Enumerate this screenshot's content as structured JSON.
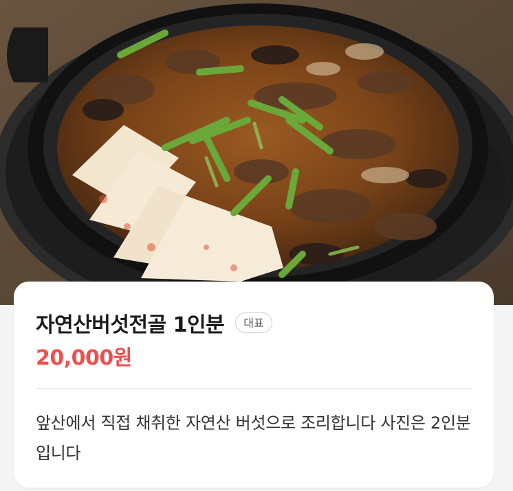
{
  "menu_item": {
    "name": "자연산버섯전골 1인분",
    "badge": "대표",
    "price": "20,000원",
    "description": "앞산에서 직접 채취한 자연산 버섯으로 조리합니다 사진은 2인분입니다"
  },
  "photo": {
    "subject": "mushroom hot pot with tofu and green onions in a black pot"
  },
  "colors": {
    "price": "#f04e4e",
    "title": "#1a1a1a",
    "badge_border": "#cfcfcf",
    "card_bg": "#ffffff"
  }
}
